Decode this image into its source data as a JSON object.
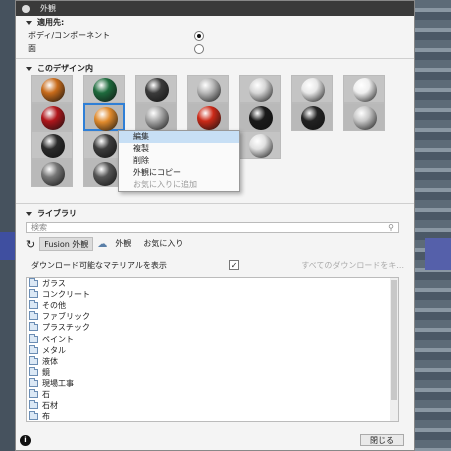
{
  "window": {
    "title": "外観"
  },
  "apply_to": {
    "header": "適用先:",
    "options": [
      {
        "label": "ボディ/コンポーネント",
        "selected": true
      },
      {
        "label": "面",
        "selected": false
      }
    ]
  },
  "in_design": {
    "header": "このデザイン内",
    "swatch_colors": [
      "#c86b1a",
      "#1e6b3d",
      "#3b3b3b",
      "#b8b8b8",
      "#d6d6d6",
      "#e8e8e8",
      "#efefef",
      "#b0161b",
      "#e08a2c",
      "#aaaaaa",
      "#cc2a18",
      "#1a1a1a",
      "#222222",
      "#c9c9c9",
      "#2b2b2b",
      "#3d3d3d",
      "#f0f0f0",
      "#9c9c9c",
      "#e0e0e0",
      "#777777",
      "#555555",
      "#aaaaaa",
      "#d41f1b"
    ]
  },
  "context_menu": {
    "items": [
      "編集",
      "複製",
      "削除",
      "外観にコピー",
      "お気に入りに追加"
    ],
    "highlighted": "編集",
    "disabled": [
      "お気に入りに追加"
    ]
  },
  "library": {
    "header": "ライブラリ",
    "search_placeholder": "検索",
    "tabs": [
      "Fusion 外観",
      "外観",
      "お気に入り"
    ],
    "active_tab": "Fusion 外観",
    "show_downloadable_label": "ダウンロード可能なマテリアルを表示",
    "show_downloadable_checked": true,
    "download_all_label": "すべてのダウンロードをキ...",
    "items": [
      "ガラス",
      "コンクリート",
      "その他",
      "ファブリック",
      "プラスチック",
      "ペイント",
      "メタル",
      "液体",
      "鏡",
      "現場工事",
      "石",
      "石材",
      "布",
      "木材"
    ]
  },
  "footer": {
    "info_symbol": "i",
    "close_label": "閉じる"
  },
  "colors": {
    "selection_blue": "#2f7fd6",
    "titlebar": "#3a3a3a"
  }
}
